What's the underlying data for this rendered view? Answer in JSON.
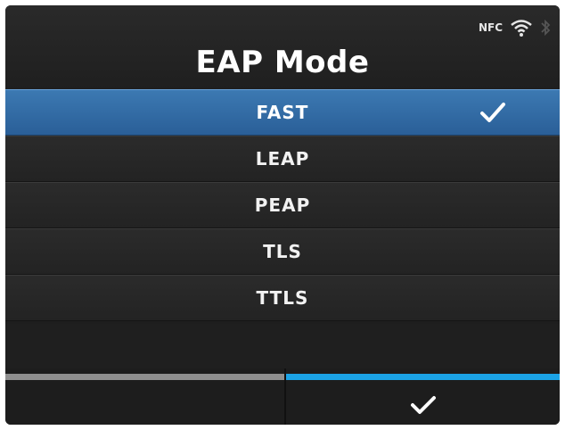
{
  "header": {
    "title": "EAP Mode",
    "status": {
      "nfc_label": "NFC",
      "wifi_icon": "wifi-icon",
      "bluetooth_icon": "bluetooth-icon"
    }
  },
  "list": {
    "items": [
      {
        "label": "FAST",
        "selected": true
      },
      {
        "label": "LEAP",
        "selected": false
      },
      {
        "label": "PEAP",
        "selected": false
      },
      {
        "label": "TLS",
        "selected": false
      },
      {
        "label": "TTLS",
        "selected": false
      }
    ]
  },
  "footer": {
    "left_button": {
      "icon": "none"
    },
    "right_button": {
      "icon": "checkmark-icon"
    }
  },
  "colors": {
    "selected_row": "#2f6aa6",
    "accent_blue": "#1ba3e6",
    "inactive_gray": "#8f8f8f",
    "background": "#1e1e1e"
  }
}
